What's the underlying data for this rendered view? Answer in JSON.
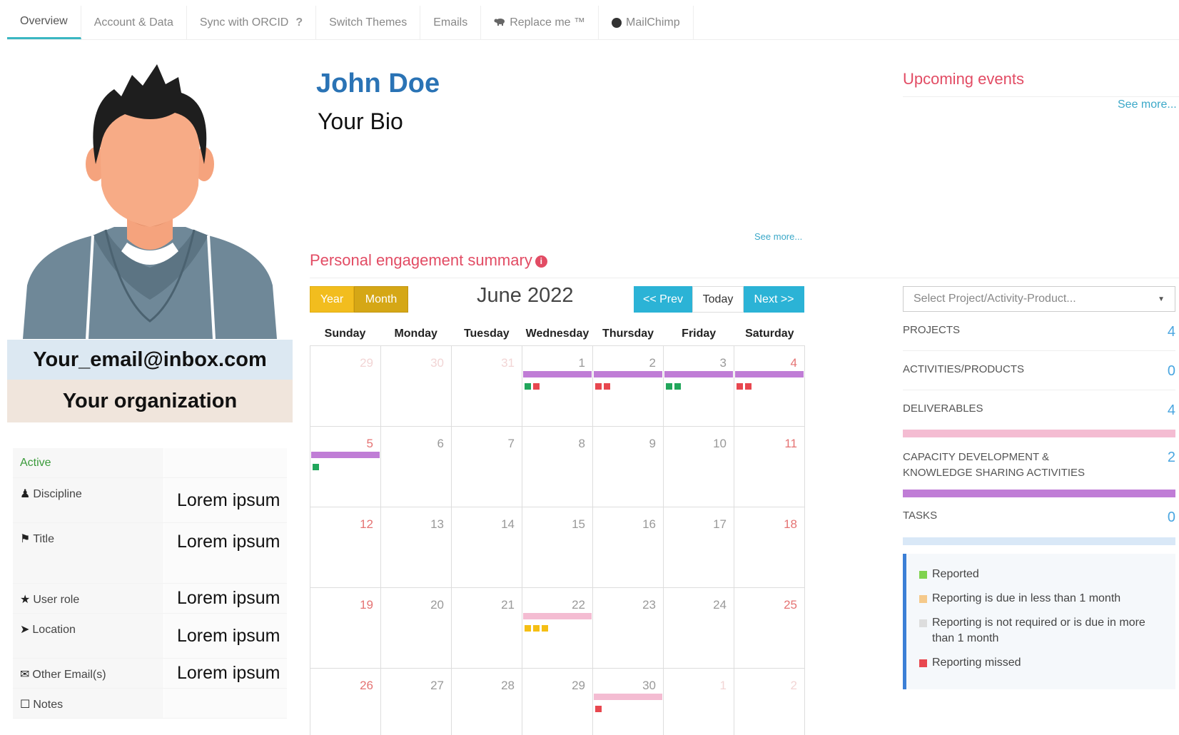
{
  "tabs": [
    {
      "label": "Overview",
      "active": true
    },
    {
      "label": "Account & Data"
    },
    {
      "label": "Sync with ORCID",
      "suffix": "?"
    },
    {
      "label": "Switch Themes"
    },
    {
      "label": "Emails"
    },
    {
      "label": "Replace me ™",
      "icon": "cow-icon"
    },
    {
      "label": "MailChimp",
      "icon": "mailchimp-icon"
    }
  ],
  "profile": {
    "email": "Your_email@inbox.com",
    "organization": "Your organization",
    "fields": [
      {
        "label": "Active",
        "value": "",
        "icon": ""
      },
      {
        "label": "Discipline",
        "value": "Lorem ipsum",
        "icon": "user-icon"
      },
      {
        "label": "Title",
        "value": "Lorem ipsum",
        "icon": "tag-icon"
      },
      {
        "label": "User role",
        "value": "Lorem ipsum",
        "icon": "star-icon"
      },
      {
        "label": "Location",
        "value": "Lorem ipsum",
        "icon": "location-arrow-icon"
      },
      {
        "label": "Other Email(s)",
        "value": "Lorem ipsum",
        "icon": "envelope-icon"
      },
      {
        "label": "Notes",
        "value": "",
        "icon": "notes-icon"
      }
    ]
  },
  "header": {
    "name": "John Doe",
    "bio": "Your Bio",
    "see_more": "See more..."
  },
  "engagement": {
    "title": "Personal engagement summary",
    "year_label": "Year",
    "month_label": "Month",
    "calendar_title": "June 2022",
    "prev_label": "<< Prev",
    "today_label": "Today",
    "next_label": "Next >>",
    "weekdays": [
      "Sunday",
      "Monday",
      "Tuesday",
      "Wednesday",
      "Thursday",
      "Friday",
      "Saturday"
    ],
    "days": [
      29,
      30,
      31,
      1,
      2,
      3,
      4,
      5,
      6,
      7,
      8,
      9,
      10,
      11,
      12,
      13,
      14,
      15,
      16,
      17,
      18,
      19,
      20,
      21,
      22,
      23,
      24,
      25,
      26,
      27,
      28,
      29,
      30,
      1,
      2
    ],
    "other_month_cells": [
      0,
      1,
      2,
      33,
      34
    ],
    "events": [
      {
        "cell": 3,
        "bar": "purple",
        "squares": [
          "green",
          "red"
        ]
      },
      {
        "cell": 4,
        "bar": "purple",
        "squares": [
          "red",
          "red"
        ]
      },
      {
        "cell": 5,
        "bar": "purple",
        "squares": [
          "green",
          "green"
        ]
      },
      {
        "cell": 6,
        "bar": "purple",
        "squares": [
          "red",
          "red"
        ]
      },
      {
        "cell": 7,
        "bar": "purple",
        "squares": [
          "green"
        ]
      },
      {
        "cell": 24,
        "bar": "pink",
        "squares": [
          "yellow",
          "yellow",
          "yellow"
        ]
      },
      {
        "cell": 32,
        "bar": "pink",
        "squares": [
          "red"
        ]
      }
    ]
  },
  "upcoming": {
    "title": "Upcoming events",
    "see_more": "See more..."
  },
  "sidebar": {
    "select_placeholder": "Select Project/Activity-Product...",
    "stats": [
      {
        "label": "PROJECTS",
        "count": "4"
      },
      {
        "label": "ACTIVITIES/PRODUCTS",
        "count": "0"
      },
      {
        "label": "DELIVERABLES",
        "count": "4"
      },
      {
        "label": "CAPACITY DEVELOPMENT & KNOWLEDGE SHARING ACTIVITIES",
        "count": "2"
      },
      {
        "label": "TASKS",
        "count": "0"
      }
    ],
    "legend": [
      {
        "label": "Reported",
        "color": "#7fd34e"
      },
      {
        "label": "Reporting is due in less than 1 month",
        "color": "#f5c98a"
      },
      {
        "label": "Reporting is not required or is due in more than 1 month",
        "color": "#dddddd"
      },
      {
        "label": "Reporting missed",
        "color": "#e8474f"
      }
    ]
  },
  "colors": {
    "accent": "#3bb7c2",
    "name_blue": "#2a73b5",
    "section_red": "#e24c64",
    "bar_purple": "#c07dd6",
    "bar_pink": "#f4bcd2",
    "square_green": "#21a65b",
    "square_red": "#e8474f",
    "square_yellow": "#f5bf14"
  }
}
